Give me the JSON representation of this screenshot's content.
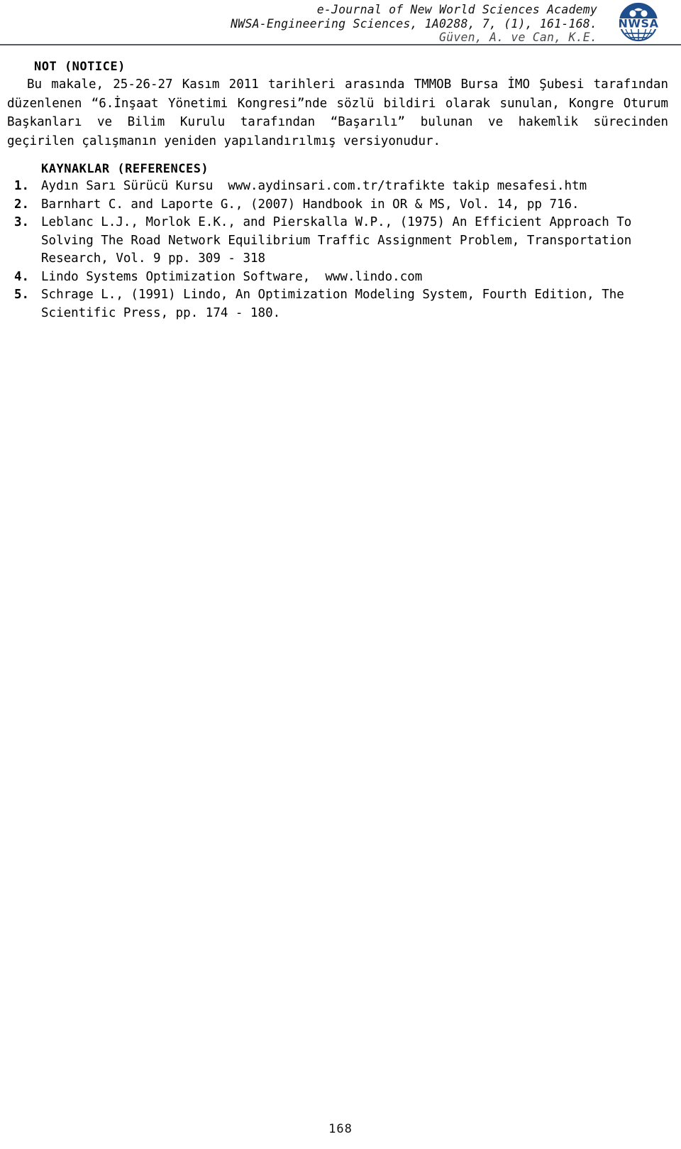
{
  "header": {
    "line1": "e-Journal of New World Sciences Academy",
    "line2": "NWSA-Engineering Sciences, 1A0288, 7, (1), 161-168.",
    "line3": "Güven, A. ve Can, K.E.",
    "logo_alt": "NWSA",
    "logo_color": "#1f4e8c"
  },
  "notice": {
    "title": "NOT (NOTICE)",
    "body": "Bu makale, 25-26-27 Kasım 2011 tarihleri arasında TMMOB Bursa İMO Şubesi tarafından düzenlenen “6.İnşaat Yönetimi Kongresi”nde sözlü bildiri olarak sunulan, Kongre Oturum Başkanları ve Bilim Kurulu tarafından “Başarılı” bulunan ve hakemlik sürecinden geçirilen çalışmanın yeniden yapılandırılmış versiyonudur."
  },
  "references": {
    "title": "KAYNAKLAR (REFERENCES)",
    "items": [
      {
        "number": "1.",
        "text": "Aydın Sarı Sürücü Kursu  www.aydinsari.com.tr/trafikte takip mesafesi.htm"
      },
      {
        "number": "2.",
        "text": "Barnhart C. and Laporte G., (2007) Handbook in OR & MS, Vol. 14, pp 716."
      },
      {
        "number": "3.",
        "text": "Leblanc L.J., Morlok E.K., and Pierskalla W.P., (1975) An Efficient Approach To Solving The Road Network Equilibrium Traffic Assignment Problem, Transportation Research, Vol. 9 pp. 309 - 318"
      },
      {
        "number": "4.",
        "text": "Lindo Systems Optimization Software,  www.lindo.com"
      },
      {
        "number": "5.",
        "text": "Schrage L., (1991) Lindo, An Optimization Modeling System, Fourth Edition, The Scientific Press, pp. 174 - 180."
      }
    ]
  },
  "footer": {
    "page_number": "168"
  }
}
